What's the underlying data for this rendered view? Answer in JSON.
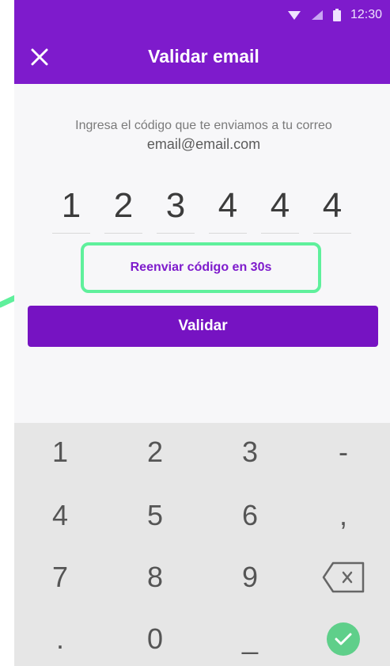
{
  "status_bar": {
    "time": "12:30"
  },
  "app_bar": {
    "title": "Validar email",
    "close_icon": "close-icon"
  },
  "verification": {
    "instruction": "Ingresa el código que te enviamos a tu correo",
    "email": "email@email.com",
    "code_digits": [
      "1",
      "2",
      "3",
      "4",
      "4",
      "4"
    ],
    "resend_label": "Reenviar código en 30s",
    "validate_label": "Validar"
  },
  "keyboard": {
    "keys": [
      "1",
      "2",
      "3",
      "-",
      "4",
      "5",
      "6",
      ",",
      "7",
      "8",
      "9",
      "backspace",
      ".",
      "0",
      "_",
      "check"
    ]
  },
  "colors": {
    "brand_purple": "#7e1bcc",
    "highlight_green": "#5ff09c",
    "confirm_green": "#5fcf8a"
  }
}
